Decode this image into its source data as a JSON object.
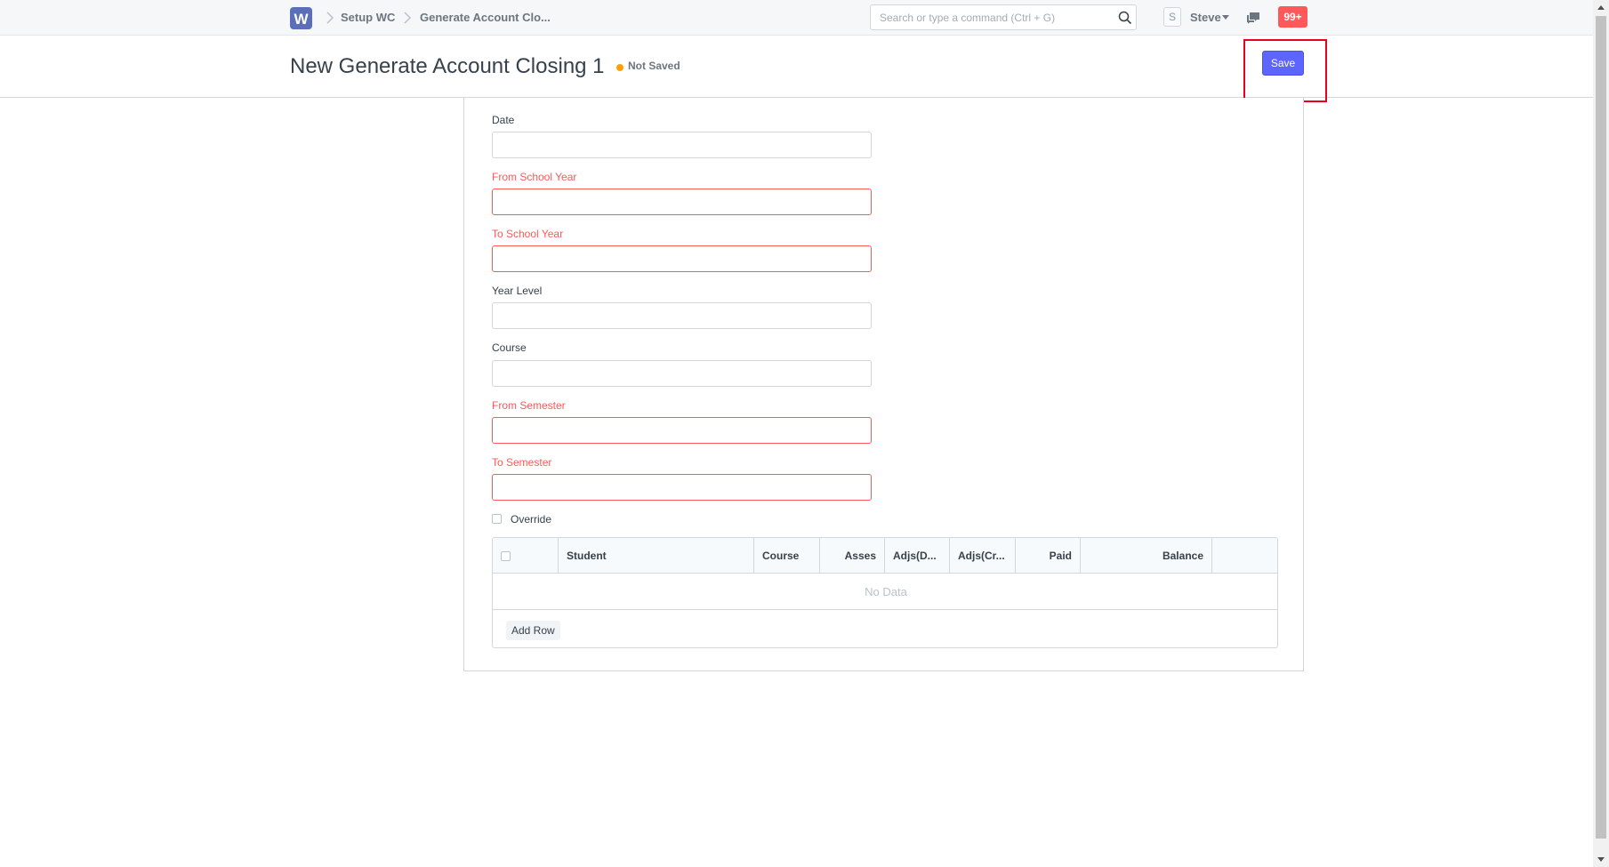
{
  "navbar": {
    "logo_letter": "W",
    "breadcrumbs": [
      "Setup WC",
      "Generate Account Clo..."
    ],
    "search_placeholder": "Search or type a command (Ctrl + G)",
    "avatar_letter": "S",
    "user_name": "Steve",
    "notification_count": "99+"
  },
  "page": {
    "title": "New Generate Account Closing 1",
    "status": "Not Saved",
    "save_label": "Save"
  },
  "form": {
    "fields": [
      {
        "label": "Date",
        "required": false,
        "value": ""
      },
      {
        "label": "From School Year",
        "required": true,
        "value": ""
      },
      {
        "label": "To School Year",
        "required": true,
        "value": ""
      },
      {
        "label": "Year Level",
        "required": false,
        "value": ""
      },
      {
        "label": "Course",
        "required": false,
        "value": ""
      },
      {
        "label": "From Semester",
        "required": true,
        "value": ""
      },
      {
        "label": "To Semester",
        "required": true,
        "value": ""
      }
    ],
    "override_label": "Override"
  },
  "grid": {
    "columns": [
      "Student",
      "Course",
      "Asses",
      "Adjs(D...",
      "Adjs(Cr...",
      "Paid",
      "Balance"
    ],
    "empty_text": "No Data",
    "add_row_label": "Add Row"
  },
  "colors": {
    "primary": "#5e64ff",
    "required": "#ff5858",
    "status_dot": "#ffa00a",
    "highlight": "#e8001c",
    "badge": "#ff5858"
  },
  "icons": [
    "logo-icon",
    "chevron-right-icon",
    "search-icon",
    "caret-down-icon",
    "chat-icon",
    "arrow-annotation-icon"
  ]
}
